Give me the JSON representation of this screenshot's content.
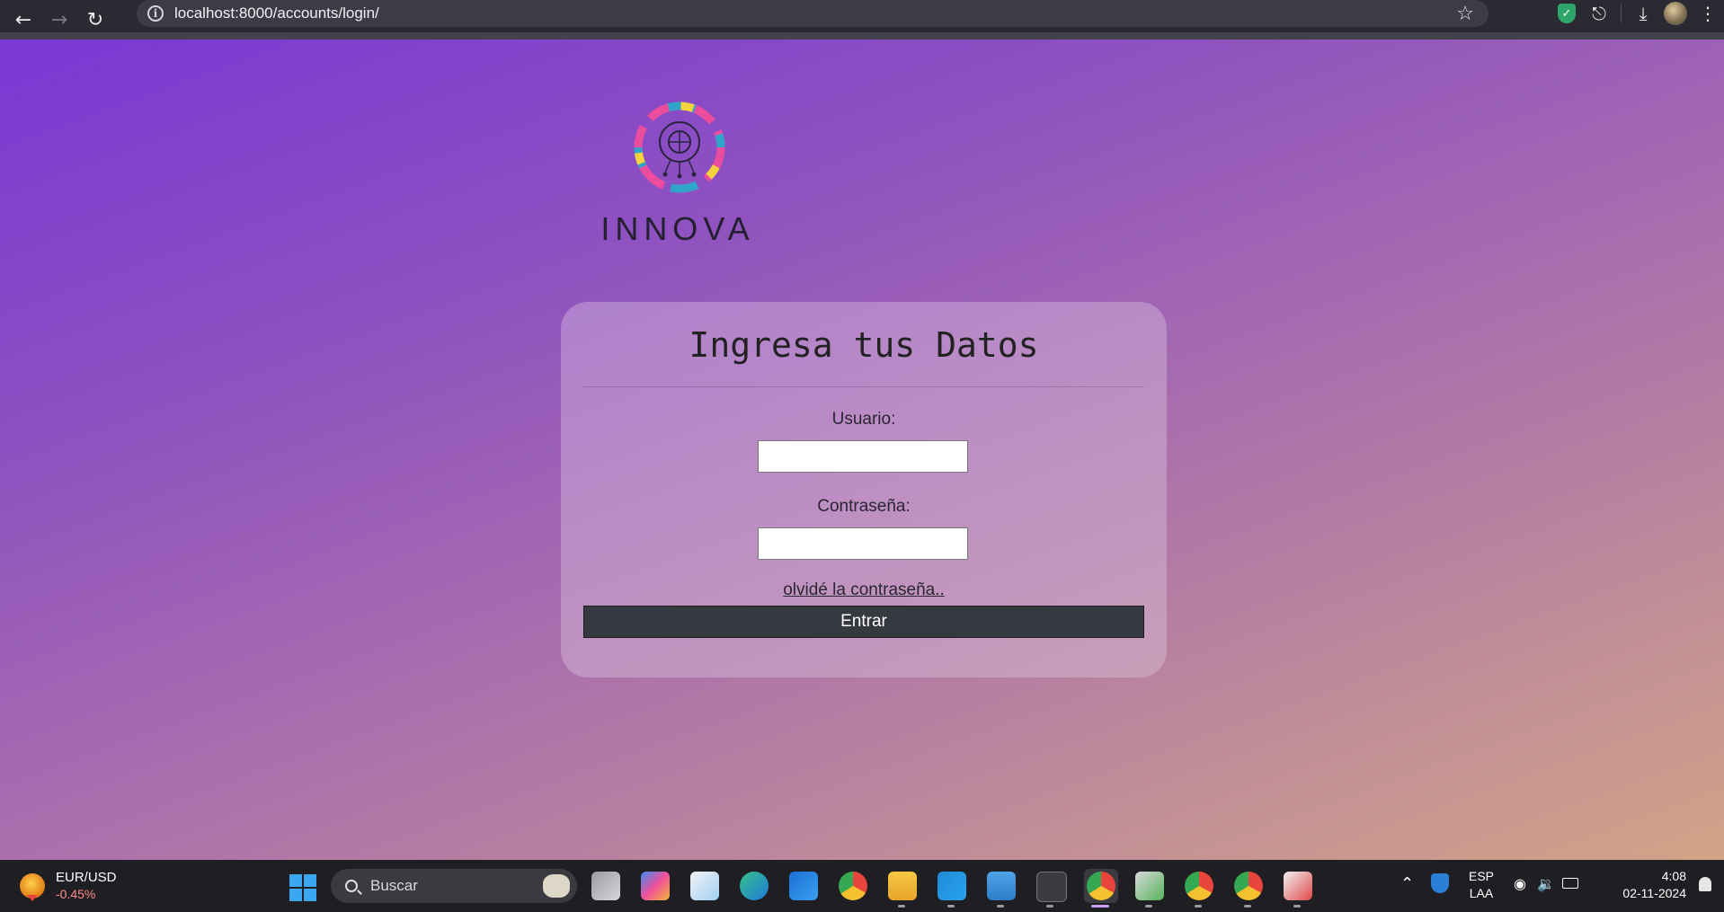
{
  "browser": {
    "url": "localhost:8000/accounts/login/"
  },
  "page": {
    "logo_text": "INNOVA",
    "card": {
      "title": "Ingresa tus Datos",
      "username_label": "Usuario:",
      "username_value": "",
      "password_label": "Contraseña:",
      "password_value": "",
      "forgot_link": "olvidé la contraseña..",
      "submit_label": "Entrar"
    }
  },
  "taskbar": {
    "widget": {
      "name": "EUR/USD",
      "change": "-0.45%"
    },
    "search_placeholder": "Buscar",
    "apps": [
      "task-view",
      "copilot",
      "microsoft-store",
      "edge",
      "outlook",
      "chrome",
      "file-explorer",
      "vscode",
      "notepad",
      "terminal",
      "chrome-active",
      "media-app",
      "chrome-profile",
      "chrome",
      "snipping-tool"
    ],
    "tray": {
      "language_line1": "ESP",
      "language_line2": "LAA",
      "time": "4:08",
      "date": "02-11-2024"
    }
  },
  "colors": {
    "gradient_start": "#7a38d4",
    "gradient_end": "#d2a387",
    "button": "#363a40",
    "taskbar": "#1f1f23",
    "chrome": "#2b2a33"
  }
}
